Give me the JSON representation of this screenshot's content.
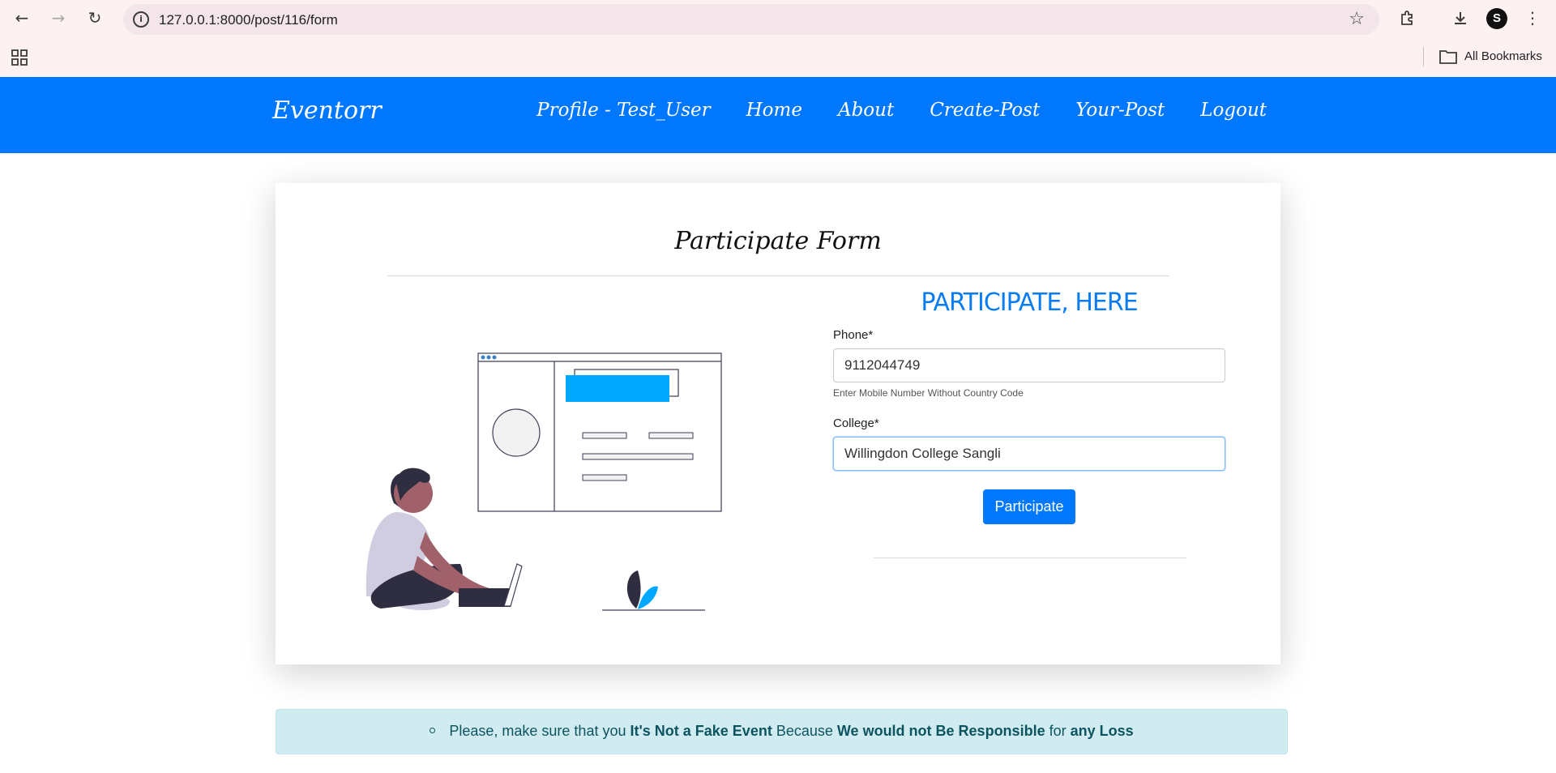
{
  "browser": {
    "url": "127.0.0.1:8000/post/116/form",
    "bookmarks_label": "All Bookmarks",
    "profile_initial": "S",
    "icons": [
      "back-icon",
      "forward-icon",
      "reload-icon",
      "site-info-icon",
      "star-icon",
      "extensions-icon",
      "download-icon",
      "menu-icon",
      "apps-icon",
      "folder-icon"
    ]
  },
  "site_nav": {
    "brand": "Eventorr",
    "links": [
      "Profile - Test_User",
      "Home",
      "About",
      "Create-Post",
      "Your-Post",
      "Logout"
    ],
    "color": "#0077ff"
  },
  "form": {
    "title": "Participate Form",
    "subheading": "PARTICIPATE, HERE",
    "phone_label": "Phone*",
    "phone_value": "9112044749",
    "phone_help": "Enter Mobile Number Without Country Code",
    "college_label": "College*",
    "college_value": "Willingdon College Sangli",
    "submit_label": "Participate"
  },
  "alert": {
    "t1": "Please, make sure that you ",
    "b1": "It's Not a Fake Event",
    "t2": " Because ",
    "b2": "We would not Be Responsible",
    "t3": " for ",
    "b3": "any Loss"
  }
}
